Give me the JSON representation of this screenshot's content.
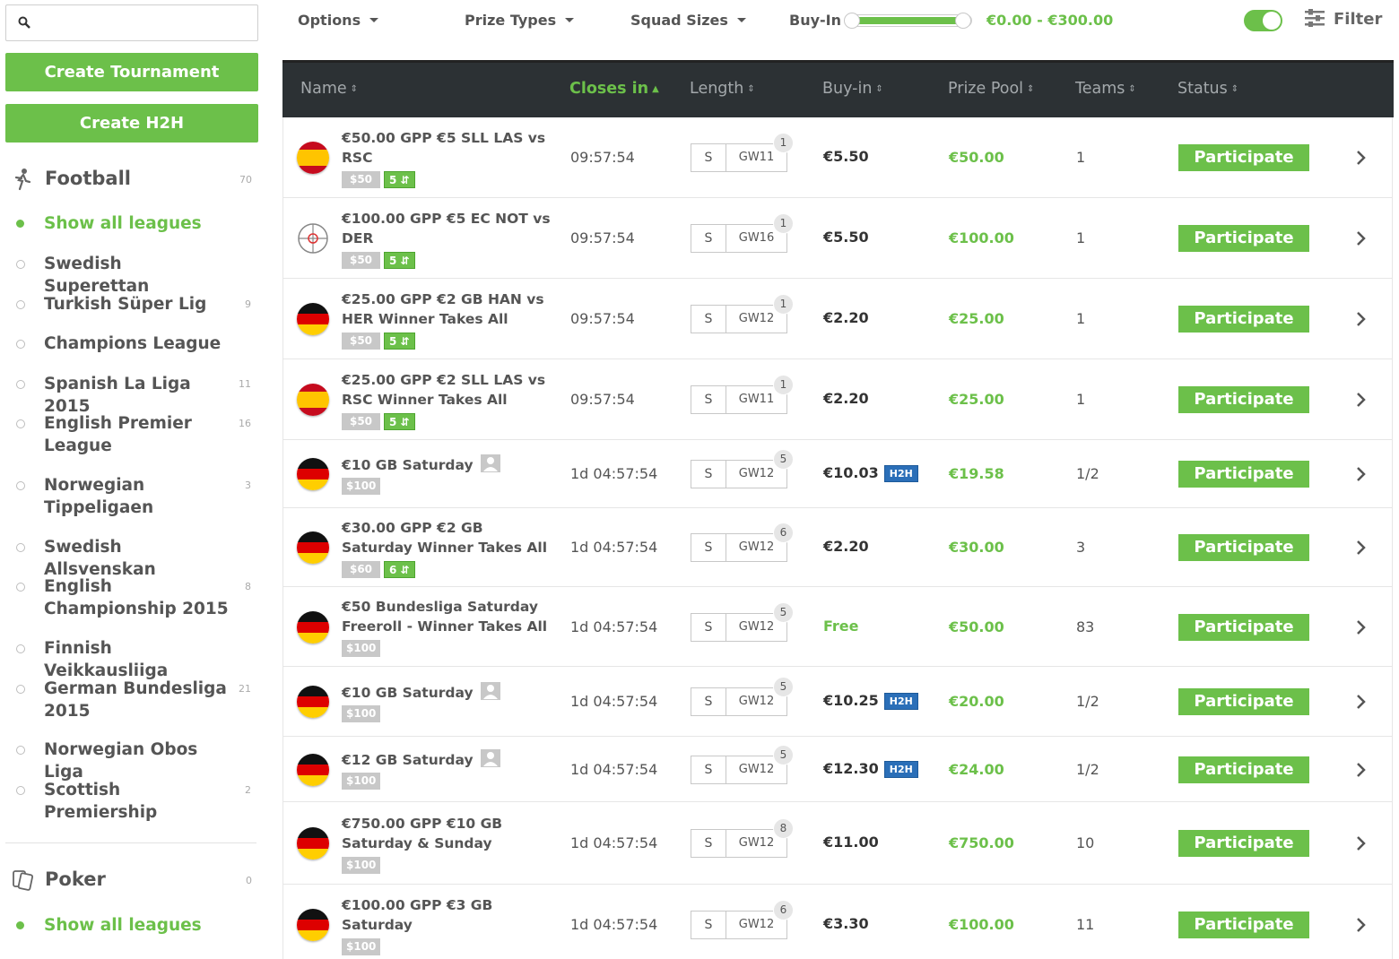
{
  "search": {
    "placeholder": "",
    "value": ""
  },
  "buttons": {
    "create_tournament": "Create Tournament",
    "create_h2h": "Create H2H"
  },
  "sports": [
    {
      "name": "Football",
      "count": "70",
      "leagues": [
        {
          "name": "Show all leagues",
          "count": "",
          "active": true
        },
        {
          "name": "Swedish Superettan",
          "count": ""
        },
        {
          "name": "Turkish Süper Lig",
          "count": "9"
        },
        {
          "name": "Champions League",
          "count": ""
        },
        {
          "name": "Spanish La Liga 2015",
          "count": "11"
        },
        {
          "name": "English Premier League",
          "count": "16"
        },
        {
          "name": "Norwegian Tippeligaen",
          "count": "3"
        },
        {
          "name": "Swedish Allsvenskan",
          "count": ""
        },
        {
          "name": "English Championship 2015",
          "count": "8"
        },
        {
          "name": "Finnish Veikkausliiga",
          "count": ""
        },
        {
          "name": "German Bundesliga 2015",
          "count": "21"
        },
        {
          "name": "Norwegian Obos Liga",
          "count": ""
        },
        {
          "name": "Scottish Premiership",
          "count": "2"
        }
      ]
    },
    {
      "name": "Poker",
      "count": "0",
      "leagues": [
        {
          "name": "Show all leagues",
          "count": "",
          "active": true
        }
      ]
    }
  ],
  "filters": {
    "options": "Options",
    "prize_types": "Prize Types",
    "squad_sizes": "Squad Sizes",
    "buyin_label": "Buy-In",
    "buyin_range": "€0.00 - €300.00",
    "buyin_min_fraction": 0,
    "buyin_max_fraction": 1,
    "toggle_on": true,
    "filter_label": "Filter"
  },
  "columns": {
    "name": "Name",
    "closes": "Closes in",
    "length": "Length",
    "buyin": "Buy-in",
    "prize": "Prize Pool",
    "teams": "Teams",
    "status": "Status"
  },
  "colors": {
    "accent": "#6cc04a",
    "header_bg": "#2c3134",
    "h2h_badge": "#2b6fb8"
  },
  "rows": [
    {
      "flag": "es",
      "name": "€50.00 GPP €5 SLL LAS vs RSC",
      "tags": [
        {
          "t": "$50",
          "c": "grey"
        },
        {
          "t": "5 ⇵",
          "c": "green"
        }
      ],
      "user_icon": false,
      "closes": "09:57:54",
      "len_s": "S",
      "len_gw": "GW11",
      "len_badge": "1",
      "buyin": "€5.50",
      "h2h": "",
      "free": false,
      "prize": "€50.00",
      "teams": "1",
      "status": "Participate"
    },
    {
      "flag": "target",
      "name": "€100.00 GPP €5 EC NOT vs DER",
      "tags": [
        {
          "t": "$50",
          "c": "grey"
        },
        {
          "t": "5 ⇵",
          "c": "green"
        }
      ],
      "user_icon": false,
      "closes": "09:57:54",
      "len_s": "S",
      "len_gw": "GW16",
      "len_badge": "1",
      "buyin": "€5.50",
      "h2h": "",
      "free": false,
      "prize": "€100.00",
      "teams": "1",
      "status": "Participate"
    },
    {
      "flag": "de",
      "name": "€25.00 GPP €2 GB HAN vs HER Winner Takes All",
      "tags": [
        {
          "t": "$50",
          "c": "grey"
        },
        {
          "t": "5 ⇵",
          "c": "green"
        }
      ],
      "user_icon": false,
      "closes": "09:57:54",
      "len_s": "S",
      "len_gw": "GW12",
      "len_badge": "1",
      "buyin": "€2.20",
      "h2h": "",
      "free": false,
      "prize": "€25.00",
      "teams": "1",
      "status": "Participate"
    },
    {
      "flag": "es",
      "name": "€25.00 GPP €2 SLL LAS vs RSC Winner Takes All",
      "tags": [
        {
          "t": "$50",
          "c": "grey"
        },
        {
          "t": "5 ⇵",
          "c": "green"
        }
      ],
      "user_icon": false,
      "closes": "09:57:54",
      "len_s": "S",
      "len_gw": "GW11",
      "len_badge": "1",
      "buyin": "€2.20",
      "h2h": "",
      "free": false,
      "prize": "€25.00",
      "teams": "1",
      "status": "Participate"
    },
    {
      "flag": "de",
      "name": "€10 GB Saturday",
      "tags": [
        {
          "t": "$100",
          "c": "grey"
        }
      ],
      "user_icon": true,
      "closes": "1d 04:57:54",
      "len_s": "S",
      "len_gw": "GW12",
      "len_badge": "5",
      "buyin": "€10.03",
      "h2h": "H2H",
      "free": false,
      "prize": "€19.58",
      "teams": "1/2",
      "status": "Participate"
    },
    {
      "flag": "de",
      "name": "€30.00 GPP €2 GB Saturday Winner Takes All",
      "tags": [
        {
          "t": "$60",
          "c": "grey"
        },
        {
          "t": "6 ⇵",
          "c": "green"
        }
      ],
      "user_icon": false,
      "closes": "1d 04:57:54",
      "len_s": "S",
      "len_gw": "GW12",
      "len_badge": "6",
      "buyin": "€2.20",
      "h2h": "",
      "free": false,
      "prize": "€30.00",
      "teams": "3",
      "status": "Participate"
    },
    {
      "flag": "de",
      "name": "€50 Bundesliga Saturday Freeroll - Winner Takes All",
      "tags": [
        {
          "t": "$100",
          "c": "grey"
        }
      ],
      "user_icon": false,
      "closes": "1d 04:57:54",
      "len_s": "S",
      "len_gw": "GW12",
      "len_badge": "5",
      "buyin": "Free",
      "h2h": "",
      "free": true,
      "prize": "€50.00",
      "teams": "83",
      "status": "Participate"
    },
    {
      "flag": "de",
      "name": "€10 GB Saturday",
      "tags": [
        {
          "t": "$100",
          "c": "grey"
        }
      ],
      "user_icon": true,
      "closes": "1d 04:57:54",
      "len_s": "S",
      "len_gw": "GW12",
      "len_badge": "5",
      "buyin": "€10.25",
      "h2h": "H2H",
      "free": false,
      "prize": "€20.00",
      "teams": "1/2",
      "status": "Participate"
    },
    {
      "flag": "de",
      "name": "€12 GB Saturday",
      "tags": [
        {
          "t": "$100",
          "c": "grey"
        }
      ],
      "user_icon": true,
      "closes": "1d 04:57:54",
      "len_s": "S",
      "len_gw": "GW12",
      "len_badge": "5",
      "buyin": "€12.30",
      "h2h": "H2H",
      "free": false,
      "prize": "€24.00",
      "teams": "1/2",
      "status": "Participate"
    },
    {
      "flag": "de",
      "name": "€750.00 GPP €10 GB Saturday & Sunday",
      "tags": [
        {
          "t": "$100",
          "c": "grey"
        }
      ],
      "user_icon": false,
      "closes": "1d 04:57:54",
      "len_s": "S",
      "len_gw": "GW12",
      "len_badge": "8",
      "buyin": "€11.00",
      "h2h": "",
      "free": false,
      "prize": "€750.00",
      "teams": "10",
      "status": "Participate"
    },
    {
      "flag": "de",
      "name": "€100.00 GPP €3 GB Saturday",
      "tags": [
        {
          "t": "$100",
          "c": "grey"
        }
      ],
      "user_icon": false,
      "closes": "1d 04:57:54",
      "len_s": "S",
      "len_gw": "GW12",
      "len_badge": "6",
      "buyin": "€3.30",
      "h2h": "",
      "free": false,
      "prize": "€100.00",
      "teams": "11",
      "status": "Participate"
    }
  ]
}
